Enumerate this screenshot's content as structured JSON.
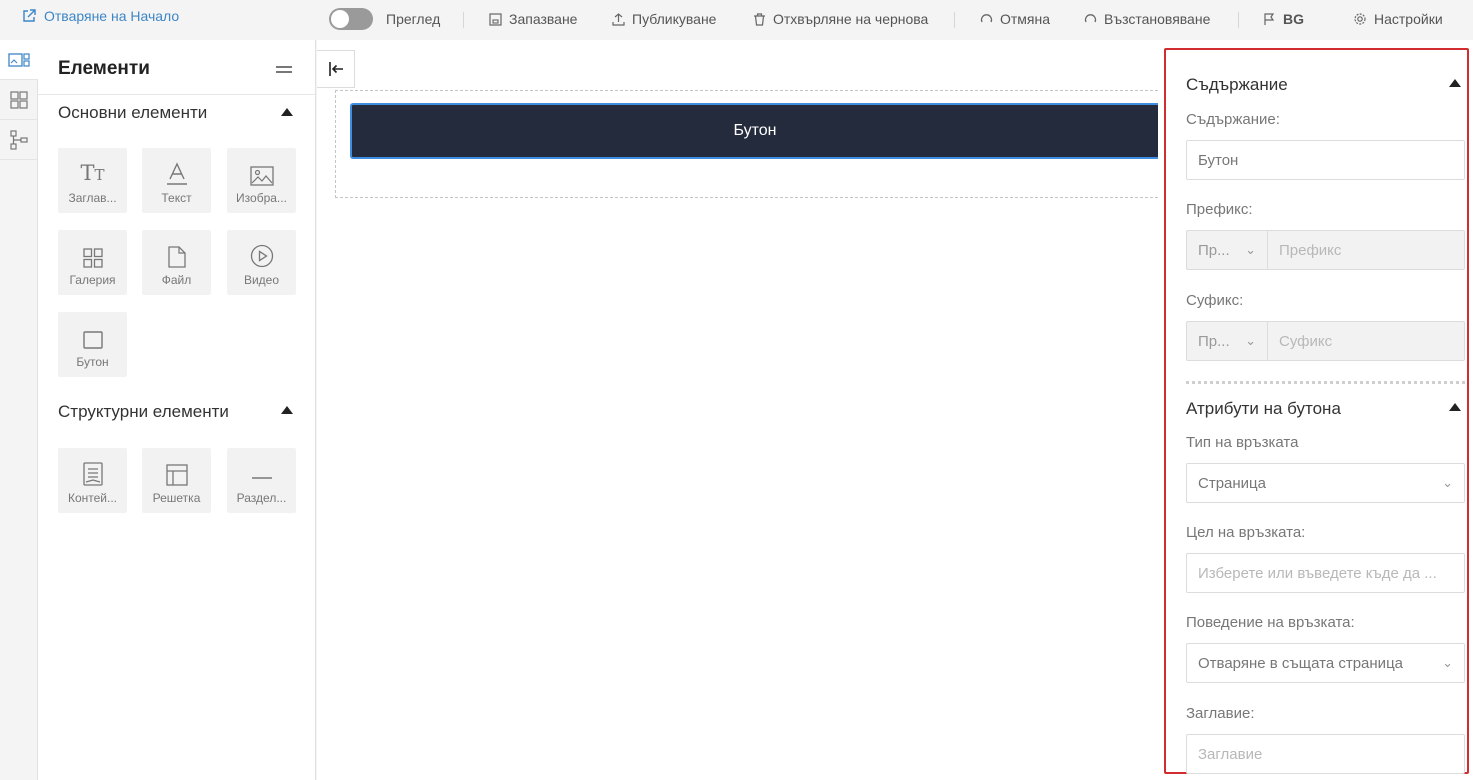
{
  "topbar": {
    "home_link": "Отваряне на Начало",
    "preview_label": "Преглед",
    "save_label": "Запазване",
    "publish_label": "Публикуване",
    "discard_label": "Отхвърляне на чернова",
    "undo_label": "Отмяна",
    "redo_label": "Възстановяване",
    "language": "BG",
    "settings_label": "Настройки"
  },
  "elements_panel": {
    "title": "Елементи",
    "basic_section": "Основни елементи",
    "basic_items": [
      {
        "label": "Заглав...",
        "icon": "heading-icon"
      },
      {
        "label": "Текст",
        "icon": "text-icon"
      },
      {
        "label": "Изобра...",
        "icon": "image-icon"
      },
      {
        "label": "Галерия",
        "icon": "gallery-icon"
      },
      {
        "label": "Файл",
        "icon": "file-icon"
      },
      {
        "label": "Видео",
        "icon": "video-icon"
      },
      {
        "label": "Бутон",
        "icon": "button-icon"
      }
    ],
    "structural_section": "Структурни елементи",
    "structural_items": [
      {
        "label": "Контей...",
        "icon": "container-icon"
      },
      {
        "label": "Решетка",
        "icon": "grid-icon"
      },
      {
        "label": "Раздел...",
        "icon": "divider-icon"
      }
    ]
  },
  "canvas": {
    "button_text": "Бутон"
  },
  "properties": {
    "content_section": "Съдържание",
    "content_label": "Съдържание:",
    "content_value": "Бутон",
    "prefix_label": "Префикс:",
    "prefix_select": "Пр...",
    "prefix_placeholder": "Префикс",
    "suffix_label": "Суфикс:",
    "suffix_select": "Пр...",
    "suffix_placeholder": "Суфикс",
    "attributes_section": "Атрибути на бутона",
    "link_type_label": "Тип на връзката",
    "link_type_value": "Страница",
    "link_target_label": "Цел на връзката:",
    "link_target_placeholder": "Изберете или въведете къде да ...",
    "link_behavior_label": "Поведение на връзката:",
    "link_behavior_value": "Отваряне в същата страница",
    "title_label": "Заглавие:",
    "title_placeholder": "Заглавие"
  },
  "colors": {
    "accent": "#3d86c6",
    "button_bg": "#242b3d",
    "highlight": "#d12c30"
  }
}
